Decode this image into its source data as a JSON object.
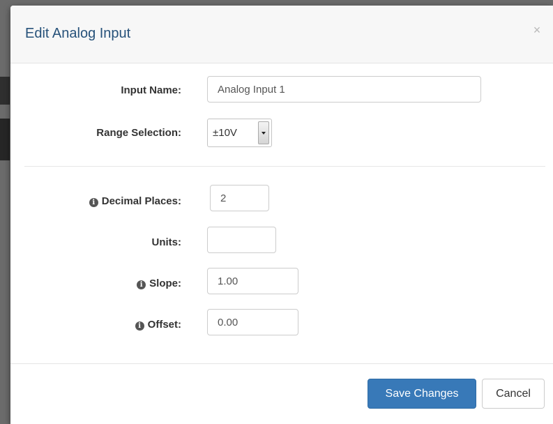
{
  "modal": {
    "title": "Edit Analog Input",
    "close_symbol": "×"
  },
  "form": {
    "input_name": {
      "label": "Input Name:",
      "value": "Analog Input 1"
    },
    "range_selection": {
      "label": "Range Selection:",
      "value": "±10V"
    },
    "decimal_places": {
      "label": "Decimal Places:",
      "value": "2",
      "info_icon": "info-circle-icon"
    },
    "units": {
      "label": "Units:",
      "value": ""
    },
    "slope": {
      "label": "Slope:",
      "value": "1.00",
      "info_icon": "info-circle-icon"
    },
    "offset": {
      "label": "Offset:",
      "value": "0.00",
      "info_icon": "info-circle-icon"
    },
    "info_glyph": "i"
  },
  "footer": {
    "save_label": "Save Changes",
    "cancel_label": "Cancel"
  },
  "colors": {
    "title": "#27527a",
    "primary_button": "#3879b8"
  }
}
